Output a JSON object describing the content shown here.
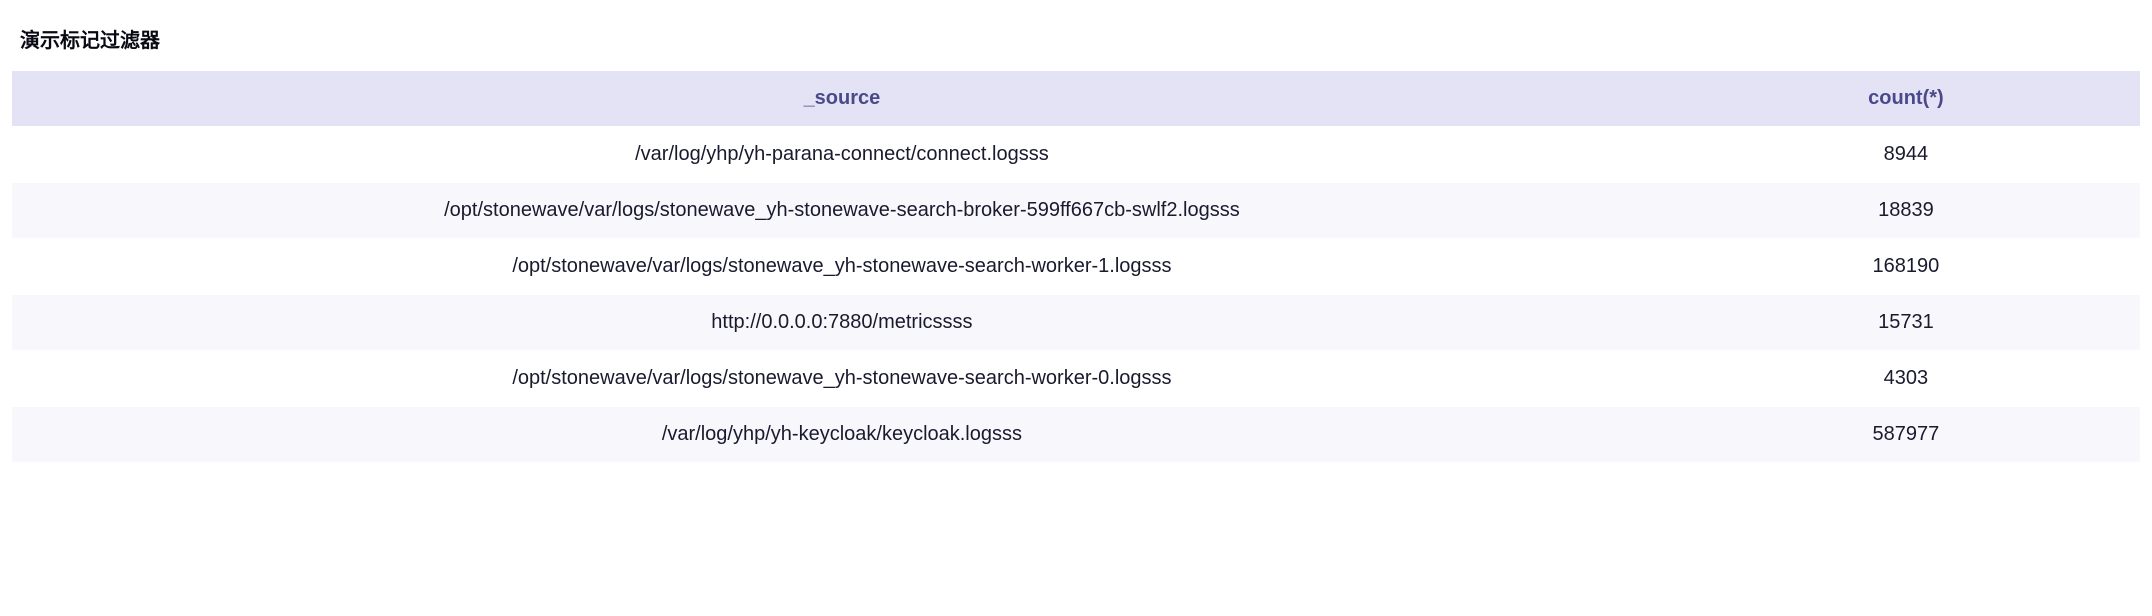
{
  "title": "演示标记过滤器",
  "columns": {
    "source": "_source",
    "count": "count(*)"
  },
  "rows": [
    {
      "source": "/var/log/yhp/yh-parana-connect/connect.logsss",
      "count": "8944"
    },
    {
      "source": "/opt/stonewave/var/logs/stonewave_yh-stonewave-search-broker-599ff667cb-swlf2.logsss",
      "count": "18839"
    },
    {
      "source": "/opt/stonewave/var/logs/stonewave_yh-stonewave-search-worker-1.logsss",
      "count": "168190"
    },
    {
      "source": "http://0.0.0.0:7880/metricssss",
      "count": "15731"
    },
    {
      "source": "/opt/stonewave/var/logs/stonewave_yh-stonewave-search-worker-0.logsss",
      "count": "4303"
    },
    {
      "source": "/var/log/yhp/yh-keycloak/keycloak.logsss",
      "count": "587977"
    }
  ]
}
